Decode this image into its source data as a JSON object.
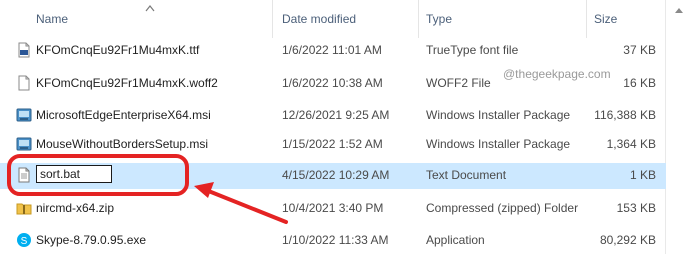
{
  "columns": {
    "name": "Name",
    "date": "Date modified",
    "type": "Type",
    "size": "Size"
  },
  "watermark": "@thegeekpage.com",
  "rename_value": "sort.bat",
  "files": [
    {
      "name": "KFOmCnqEu92Fr1Mu4mxK.ttf",
      "date": "1/6/2022 11:01 AM",
      "type": "TrueType font file",
      "size": "37 KB",
      "icon": "font-file-icon"
    },
    {
      "name": "KFOmCnqEu92Fr1Mu4mxK.woff2",
      "date": "1/6/2022 10:38 AM",
      "type": "WOFF2 File",
      "size": "16 KB",
      "icon": "generic-file-icon"
    },
    {
      "name": "MicrosoftEdgeEnterpriseX64.msi",
      "date": "12/26/2021 9:25 AM",
      "type": "Windows Installer Package",
      "size": "116,388 KB",
      "icon": "installer-icon"
    },
    {
      "name": "MouseWithoutBordersSetup.msi",
      "date": "1/15/2022 1:52 AM",
      "type": "Windows Installer Package",
      "size": "1,364 KB",
      "icon": "installer-icon"
    },
    {
      "name": "sort.bat",
      "date": "4/15/2022 10:29 AM",
      "type": "Text Document",
      "size": "1 KB",
      "icon": "text-file-icon"
    },
    {
      "name": "nircmd-x64.zip",
      "date": "10/4/2021 3:40 PM",
      "type": "Compressed (zipped) Folder",
      "size": "153 KB",
      "icon": "zip-folder-icon"
    },
    {
      "name": "Skype-8.79.0.95.exe",
      "date": "1/10/2022 11:33 AM",
      "type": "Application",
      "size": "80,292 KB",
      "icon": "skype-app-icon"
    }
  ],
  "colors": {
    "selection": "#cce8ff",
    "highlight": "#e42323",
    "header_text": "#4c607a"
  }
}
